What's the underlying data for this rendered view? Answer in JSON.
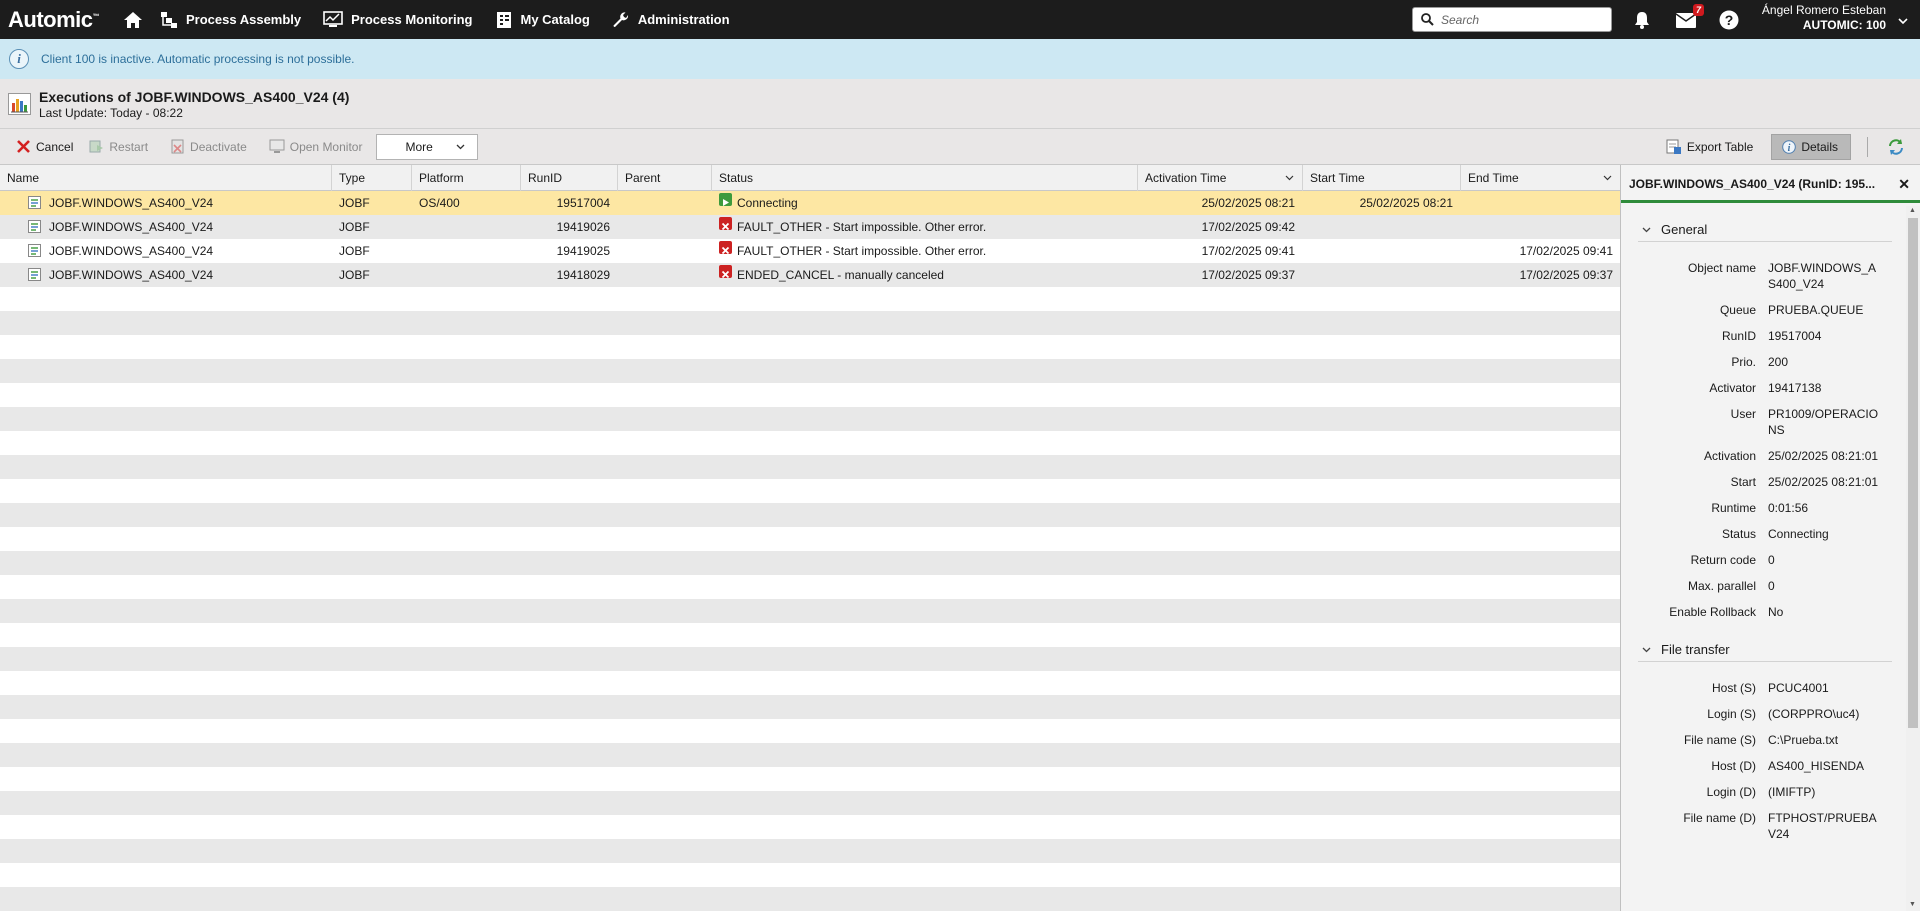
{
  "app": {
    "logo": "Automic",
    "nav": [
      {
        "label": "Process Assembly",
        "icon": "process-assembly-icon"
      },
      {
        "label": "Process Monitoring",
        "icon": "process-monitoring-icon"
      },
      {
        "label": "My Catalog",
        "icon": "catalog-icon"
      },
      {
        "label": "Administration",
        "icon": "wrench-icon"
      }
    ],
    "search_placeholder": "Search",
    "mail_badge": "7",
    "user_name": "Ángel Romero Esteban",
    "client": "AUTOMIC: 100"
  },
  "banner": {
    "text": "Client 100 is inactive. Automatic processing is not possible."
  },
  "header": {
    "title": "Executions of JOBF.WINDOWS_AS400_V24 (4)",
    "subtitle": "Last Update: Today - 08:22"
  },
  "toolbar": {
    "cancel": "Cancel",
    "restart": "Restart",
    "deactivate": "Deactivate",
    "open_monitor": "Open Monitor",
    "more": "More",
    "export_table": "Export Table",
    "details": "Details"
  },
  "table": {
    "columns": {
      "name": "Name",
      "type": "Type",
      "platform": "Platform",
      "runid": "RunID",
      "parent": "Parent",
      "status": "Status",
      "activation": "Activation Time",
      "start": "Start Time",
      "end": "End Time"
    },
    "rows": [
      {
        "name": "JOBF.WINDOWS_AS400_V24",
        "type": "JOBF",
        "platform": "OS/400",
        "runid": "19517004",
        "parent": "",
        "status": "Connecting",
        "status_kind": "running",
        "activation": "25/02/2025 08:21",
        "start": "25/02/2025 08:21",
        "end": ""
      },
      {
        "name": "JOBF.WINDOWS_AS400_V24",
        "type": "JOBF",
        "platform": "",
        "runid": "19419026",
        "parent": "",
        "status": "FAULT_OTHER - Start impossible. Other error.",
        "status_kind": "error",
        "activation": "17/02/2025 09:42",
        "start": "",
        "end": ""
      },
      {
        "name": "JOBF.WINDOWS_AS400_V24",
        "type": "JOBF",
        "platform": "",
        "runid": "19419025",
        "parent": "",
        "status": "FAULT_OTHER - Start impossible. Other error.",
        "status_kind": "error",
        "activation": "17/02/2025 09:41",
        "start": "",
        "end": "17/02/2025 09:41"
      },
      {
        "name": "JOBF.WINDOWS_AS400_V24",
        "type": "JOBF",
        "platform": "",
        "runid": "19418029",
        "parent": "",
        "status": "ENDED_CANCEL - manually canceled",
        "status_kind": "error",
        "activation": "17/02/2025 09:37",
        "start": "",
        "end": "17/02/2025 09:37"
      }
    ]
  },
  "details": {
    "title": "JOBF.WINDOWS_AS400_V24 (RunID: 195...",
    "general_title": "General",
    "general": [
      {
        "k": "Object name",
        "v": "JOBF.WINDOWS_AS400_V24"
      },
      {
        "k": "Queue",
        "v": "PRUEBA.QUEUE"
      },
      {
        "k": "RunID",
        "v": "19517004"
      },
      {
        "k": "Prio.",
        "v": "200"
      },
      {
        "k": "Activator",
        "v": "19417138"
      },
      {
        "k": "User",
        "v": "PR1009/OPERACIONS"
      },
      {
        "k": "Activation",
        "v": "25/02/2025 08:21:01"
      },
      {
        "k": "Start",
        "v": "25/02/2025 08:21:01"
      },
      {
        "k": "Runtime",
        "v": "0:01:56"
      },
      {
        "k": "Status",
        "v": "Connecting"
      },
      {
        "k": "Return code",
        "v": "0"
      },
      {
        "k": "Max. parallel",
        "v": "0"
      },
      {
        "k": "Enable Rollback",
        "v": "No"
      }
    ],
    "filetransfer_title": "File transfer",
    "filetransfer": [
      {
        "k": "Host (S)",
        "v": "PCUC4001"
      },
      {
        "k": "Login (S)",
        "v": "(CORPPRO\\uc4)"
      },
      {
        "k": "File name (S)",
        "v": "C:\\Prueba.txt"
      },
      {
        "k": "Host (D)",
        "v": "AS400_HISENDA"
      },
      {
        "k": "Login (D)",
        "v": "(IMIFTP)"
      },
      {
        "k": "File name (D)",
        "v": "FTPHOST/PRUEBAV24"
      }
    ]
  },
  "colors": {
    "topbar": "#1c1c1c",
    "banner": "#cde8f3",
    "selected_row": "#fde7a3",
    "accent_green": "#2e8b3a",
    "error_red": "#cc2222"
  }
}
